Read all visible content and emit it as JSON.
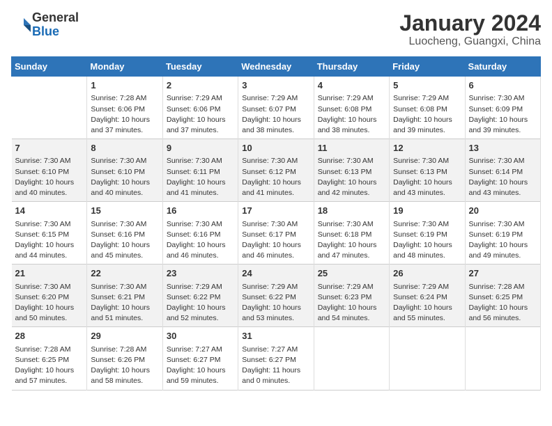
{
  "header": {
    "logo_general": "General",
    "logo_blue": "Blue",
    "title": "January 2024",
    "subtitle": "Luocheng, Guangxi, China"
  },
  "days_of_week": [
    "Sunday",
    "Monday",
    "Tuesday",
    "Wednesday",
    "Thursday",
    "Friday",
    "Saturday"
  ],
  "weeks": [
    [
      {
        "day": "",
        "info": ""
      },
      {
        "day": "1",
        "info": "Sunrise: 7:28 AM\nSunset: 6:06 PM\nDaylight: 10 hours\nand 37 minutes."
      },
      {
        "day": "2",
        "info": "Sunrise: 7:29 AM\nSunset: 6:06 PM\nDaylight: 10 hours\nand 37 minutes."
      },
      {
        "day": "3",
        "info": "Sunrise: 7:29 AM\nSunset: 6:07 PM\nDaylight: 10 hours\nand 38 minutes."
      },
      {
        "day": "4",
        "info": "Sunrise: 7:29 AM\nSunset: 6:08 PM\nDaylight: 10 hours\nand 38 minutes."
      },
      {
        "day": "5",
        "info": "Sunrise: 7:29 AM\nSunset: 6:08 PM\nDaylight: 10 hours\nand 39 minutes."
      },
      {
        "day": "6",
        "info": "Sunrise: 7:30 AM\nSunset: 6:09 PM\nDaylight: 10 hours\nand 39 minutes."
      }
    ],
    [
      {
        "day": "7",
        "info": "Sunrise: 7:30 AM\nSunset: 6:10 PM\nDaylight: 10 hours\nand 40 minutes."
      },
      {
        "day": "8",
        "info": "Sunrise: 7:30 AM\nSunset: 6:10 PM\nDaylight: 10 hours\nand 40 minutes."
      },
      {
        "day": "9",
        "info": "Sunrise: 7:30 AM\nSunset: 6:11 PM\nDaylight: 10 hours\nand 41 minutes."
      },
      {
        "day": "10",
        "info": "Sunrise: 7:30 AM\nSunset: 6:12 PM\nDaylight: 10 hours\nand 41 minutes."
      },
      {
        "day": "11",
        "info": "Sunrise: 7:30 AM\nSunset: 6:13 PM\nDaylight: 10 hours\nand 42 minutes."
      },
      {
        "day": "12",
        "info": "Sunrise: 7:30 AM\nSunset: 6:13 PM\nDaylight: 10 hours\nand 43 minutes."
      },
      {
        "day": "13",
        "info": "Sunrise: 7:30 AM\nSunset: 6:14 PM\nDaylight: 10 hours\nand 43 minutes."
      }
    ],
    [
      {
        "day": "14",
        "info": "Sunrise: 7:30 AM\nSunset: 6:15 PM\nDaylight: 10 hours\nand 44 minutes."
      },
      {
        "day": "15",
        "info": "Sunrise: 7:30 AM\nSunset: 6:16 PM\nDaylight: 10 hours\nand 45 minutes."
      },
      {
        "day": "16",
        "info": "Sunrise: 7:30 AM\nSunset: 6:16 PM\nDaylight: 10 hours\nand 46 minutes."
      },
      {
        "day": "17",
        "info": "Sunrise: 7:30 AM\nSunset: 6:17 PM\nDaylight: 10 hours\nand 46 minutes."
      },
      {
        "day": "18",
        "info": "Sunrise: 7:30 AM\nSunset: 6:18 PM\nDaylight: 10 hours\nand 47 minutes."
      },
      {
        "day": "19",
        "info": "Sunrise: 7:30 AM\nSunset: 6:19 PM\nDaylight: 10 hours\nand 48 minutes."
      },
      {
        "day": "20",
        "info": "Sunrise: 7:30 AM\nSunset: 6:19 PM\nDaylight: 10 hours\nand 49 minutes."
      }
    ],
    [
      {
        "day": "21",
        "info": "Sunrise: 7:30 AM\nSunset: 6:20 PM\nDaylight: 10 hours\nand 50 minutes."
      },
      {
        "day": "22",
        "info": "Sunrise: 7:30 AM\nSunset: 6:21 PM\nDaylight: 10 hours\nand 51 minutes."
      },
      {
        "day": "23",
        "info": "Sunrise: 7:29 AM\nSunset: 6:22 PM\nDaylight: 10 hours\nand 52 minutes."
      },
      {
        "day": "24",
        "info": "Sunrise: 7:29 AM\nSunset: 6:22 PM\nDaylight: 10 hours\nand 53 minutes."
      },
      {
        "day": "25",
        "info": "Sunrise: 7:29 AM\nSunset: 6:23 PM\nDaylight: 10 hours\nand 54 minutes."
      },
      {
        "day": "26",
        "info": "Sunrise: 7:29 AM\nSunset: 6:24 PM\nDaylight: 10 hours\nand 55 minutes."
      },
      {
        "day": "27",
        "info": "Sunrise: 7:28 AM\nSunset: 6:25 PM\nDaylight: 10 hours\nand 56 minutes."
      }
    ],
    [
      {
        "day": "28",
        "info": "Sunrise: 7:28 AM\nSunset: 6:25 PM\nDaylight: 10 hours\nand 57 minutes."
      },
      {
        "day": "29",
        "info": "Sunrise: 7:28 AM\nSunset: 6:26 PM\nDaylight: 10 hours\nand 58 minutes."
      },
      {
        "day": "30",
        "info": "Sunrise: 7:27 AM\nSunset: 6:27 PM\nDaylight: 10 hours\nand 59 minutes."
      },
      {
        "day": "31",
        "info": "Sunrise: 7:27 AM\nSunset: 6:27 PM\nDaylight: 11 hours\nand 0 minutes."
      },
      {
        "day": "",
        "info": ""
      },
      {
        "day": "",
        "info": ""
      },
      {
        "day": "",
        "info": ""
      }
    ]
  ]
}
